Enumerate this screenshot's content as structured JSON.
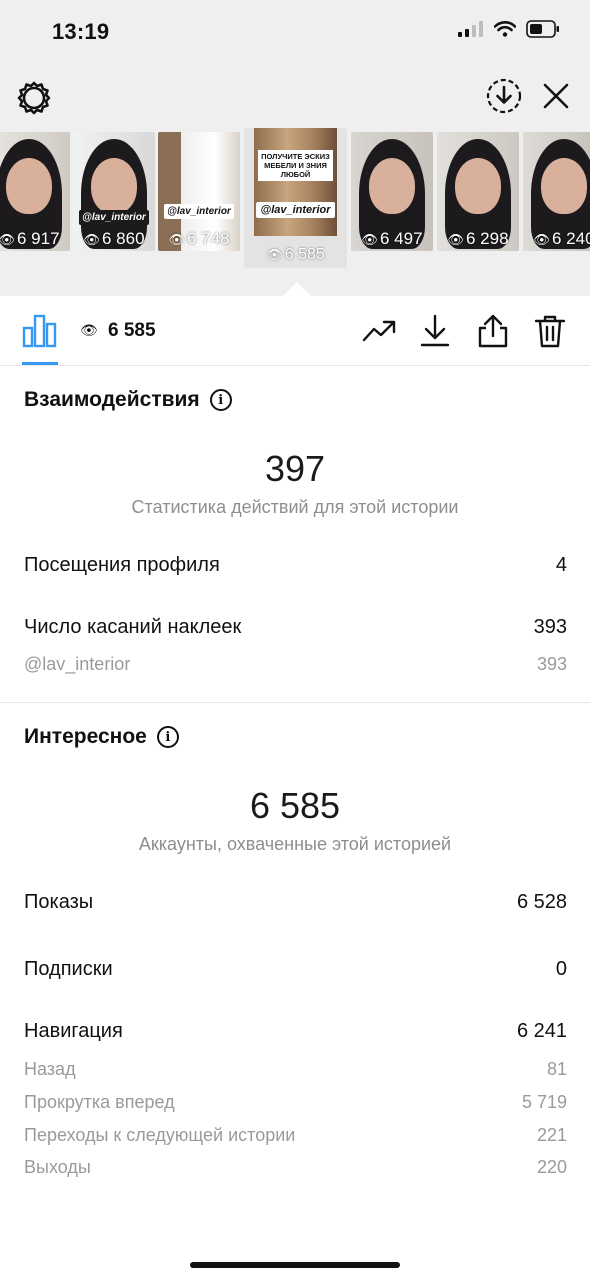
{
  "status_bar": {
    "time": "13:19",
    "icons": [
      "cellular-signal-icon",
      "wifi-icon",
      "battery-icon"
    ]
  },
  "top_actions": {
    "settings_icon": "gear-icon",
    "download_icon": "download-circle-icon",
    "close_icon": "close-icon"
  },
  "thumbnails": [
    {
      "views": "6 917",
      "tag": ""
    },
    {
      "views": "6 860",
      "tag": "@lav_interior"
    },
    {
      "views": "6 748",
      "tag": "@lav_interior"
    },
    {
      "views": "6 585",
      "tag": "@lav_interior",
      "title": "ПОЛУЧИТЕ ЭСКИЗ МЕБЕЛИ И ЗНИЯ ЛЮБОЙ",
      "selected": true
    },
    {
      "views": "6 497",
      "tag": ""
    },
    {
      "views": "6 298",
      "tag": ""
    },
    {
      "views": "6 240",
      "tag": ""
    }
  ],
  "toolbar": {
    "reach_value": "6 585",
    "icons": [
      "bar-chart-icon",
      "eye-icon",
      "trend-icon",
      "download-icon",
      "share-icon",
      "trash-icon"
    ],
    "accent_color": "#3897f0"
  },
  "interactions": {
    "title": "Взаимодействия",
    "total": "397",
    "caption": "Статистика действий для этой истории",
    "profile_visits_label": "Посещения профиля",
    "profile_visits_value": "4",
    "sticker_taps_label": "Число касаний наклеек",
    "sticker_taps_value": "393",
    "sticker_name": "@lav_interior",
    "sticker_name_value": "393"
  },
  "discovery": {
    "title": "Интересное",
    "total": "6 585",
    "caption": "Аккаунты, охваченные этой историей",
    "impressions_label": "Показы",
    "impressions_value": "6 528",
    "follows_label": "Подписки",
    "follows_value": "0",
    "navigation_label": "Навигация",
    "navigation_value": "6 241",
    "back_label": "Назад",
    "back_value": "81",
    "forward_label": "Прокрутка вперед",
    "forward_value": "5 719",
    "next_story_label": "Переходы к следующей истории",
    "next_story_value": "221",
    "exits_label": "Выходы",
    "exits_value": "220"
  }
}
